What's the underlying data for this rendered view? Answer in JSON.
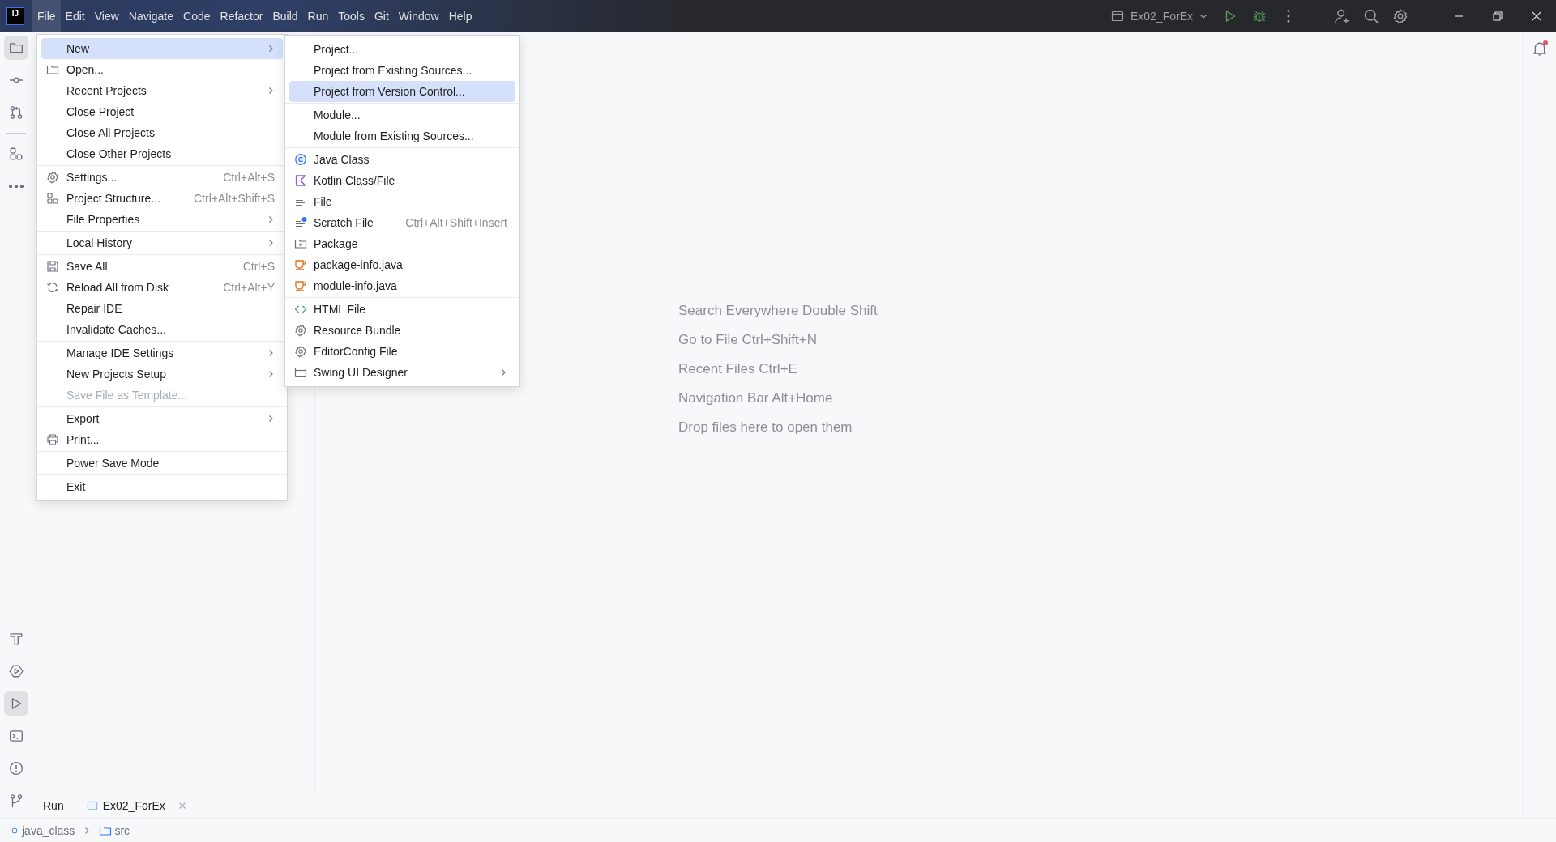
{
  "menubar": {
    "logo": "IJ",
    "items": [
      {
        "label": "File",
        "selected": true
      },
      {
        "label": "Edit",
        "selected": false
      },
      {
        "label": "View",
        "selected": false
      },
      {
        "label": "Navigate",
        "selected": false
      },
      {
        "label": "Code",
        "selected": false
      },
      {
        "label": "Refactor",
        "selected": false
      },
      {
        "label": "Build",
        "selected": false
      },
      {
        "label": "Run",
        "selected": false
      },
      {
        "label": "Tools",
        "selected": false
      },
      {
        "label": "Git",
        "selected": false
      },
      {
        "label": "Window",
        "selected": false
      },
      {
        "label": "Help",
        "selected": false
      }
    ]
  },
  "toolbar": {
    "run_configuration": "Ex02_ForEx"
  },
  "left_toolbar": {
    "top": [
      {
        "kind": "folder",
        "selected": true
      },
      {
        "kind": "commit",
        "selected": false
      },
      {
        "kind": "pull-requests",
        "selected": false
      },
      {
        "kind": "structure",
        "selected": false
      },
      {
        "kind": "more",
        "selected": false
      }
    ],
    "bottom": [
      {
        "kind": "build",
        "selected": false
      },
      {
        "kind": "services",
        "selected": false
      },
      {
        "kind": "run",
        "selected": true
      },
      {
        "kind": "terminal",
        "selected": false
      },
      {
        "kind": "problems",
        "selected": false
      },
      {
        "kind": "git",
        "selected": false
      }
    ]
  },
  "file_menu": {
    "groups": [
      [
        {
          "label": "New",
          "kind": "none",
          "submenu": true,
          "disabled": false,
          "selected": true
        },
        {
          "label": "Open...",
          "kind": "folder",
          "submenu": false,
          "disabled": false,
          "selected": false
        },
        {
          "label": "Recent Projects",
          "kind": "none",
          "submenu": true,
          "disabled": false,
          "selected": false
        },
        {
          "label": "Close Project",
          "kind": "none",
          "submenu": false,
          "disabled": false,
          "selected": false
        },
        {
          "label": "Close All Projects",
          "kind": "none",
          "submenu": false,
          "disabled": false,
          "selected": false
        },
        {
          "label": "Close Other Projects",
          "kind": "none",
          "submenu": false,
          "disabled": false,
          "selected": false
        }
      ],
      [
        {
          "label": "Settings...",
          "kind": "gear",
          "shortcut": "Ctrl+Alt+S",
          "submenu": false,
          "disabled": false,
          "selected": false
        },
        {
          "label": "Project Structure...",
          "kind": "structure",
          "shortcut": "Ctrl+Alt+Shift+S",
          "submenu": false,
          "disabled": false,
          "selected": false
        },
        {
          "label": "File Properties",
          "kind": "none",
          "submenu": true,
          "disabled": false,
          "selected": false
        }
      ],
      [
        {
          "label": "Local History",
          "kind": "none",
          "submenu": true,
          "disabled": false,
          "selected": false
        }
      ],
      [
        {
          "label": "Save All",
          "kind": "save",
          "shortcut": "Ctrl+S",
          "submenu": false,
          "disabled": false,
          "selected": false
        },
        {
          "label": "Reload All from Disk",
          "kind": "reload",
          "shortcut": "Ctrl+Alt+Y",
          "submenu": false,
          "disabled": false,
          "selected": false
        },
        {
          "label": "Repair IDE",
          "kind": "none",
          "submenu": false,
          "disabled": false,
          "selected": false
        },
        {
          "label": "Invalidate Caches...",
          "kind": "none",
          "submenu": false,
          "disabled": false,
          "selected": false
        }
      ],
      [
        {
          "label": "Manage IDE Settings",
          "kind": "none",
          "submenu": true,
          "disabled": false,
          "selected": false
        },
        {
          "label": "New Projects Setup",
          "kind": "none",
          "submenu": true,
          "disabled": false,
          "selected": false
        },
        {
          "label": "Save File as Template...",
          "kind": "none",
          "submenu": false,
          "disabled": true,
          "selected": false
        }
      ],
      [
        {
          "label": "Export",
          "kind": "none",
          "submenu": true,
          "disabled": false,
          "selected": false
        },
        {
          "label": "Print...",
          "kind": "print",
          "submenu": false,
          "disabled": false,
          "selected": false
        }
      ],
      [
        {
          "label": "Power Save Mode",
          "kind": "none",
          "submenu": false,
          "disabled": false,
          "selected": false
        }
      ],
      [
        {
          "label": "Exit",
          "kind": "none",
          "submenu": false,
          "disabled": false,
          "selected": false
        }
      ]
    ]
  },
  "new_submenu": {
    "groups": [
      [
        {
          "label": "Project...",
          "kind": "none",
          "submenu": false,
          "disabled": false,
          "selected": false
        },
        {
          "label": "Project from Existing Sources...",
          "kind": "none",
          "submenu": false,
          "disabled": false,
          "selected": false
        },
        {
          "label": "Project from Version Control...",
          "kind": "none",
          "submenu": false,
          "disabled": false,
          "selected": true
        }
      ],
      [
        {
          "label": "Module...",
          "kind": "none",
          "submenu": false,
          "disabled": false,
          "selected": false
        },
        {
          "label": "Module from Existing Sources...",
          "kind": "none",
          "submenu": false,
          "disabled": false,
          "selected": false
        }
      ],
      [
        {
          "label": "Java Class",
          "kind": "java-class",
          "submenu": false,
          "disabled": false,
          "selected": false
        },
        {
          "label": "Kotlin Class/File",
          "kind": "kotlin",
          "submenu": false,
          "disabled": false,
          "selected": false
        },
        {
          "label": "File",
          "kind": "file",
          "submenu": false,
          "disabled": false,
          "selected": false
        },
        {
          "label": "Scratch File",
          "kind": "scratch",
          "shortcut": "Ctrl+Alt+Shift+Insert",
          "submenu": false,
          "disabled": false,
          "selected": false
        },
        {
          "label": "Package",
          "kind": "package",
          "submenu": false,
          "disabled": false,
          "selected": false
        },
        {
          "label": "package-info.java",
          "kind": "java-file",
          "submenu": false,
          "disabled": false,
          "selected": false
        },
        {
          "label": "module-info.java",
          "kind": "java-file",
          "submenu": false,
          "disabled": false,
          "selected": false
        }
      ],
      [
        {
          "label": "HTML File",
          "kind": "html",
          "submenu": false,
          "disabled": false,
          "selected": false
        },
        {
          "label": "Resource Bundle",
          "kind": "gear",
          "submenu": false,
          "disabled": false,
          "selected": false
        },
        {
          "label": "EditorConfig File",
          "kind": "gear",
          "submenu": false,
          "disabled": false,
          "selected": false
        },
        {
          "label": "Swing UI Designer",
          "kind": "window",
          "submenu": true,
          "disabled": false,
          "selected": false
        }
      ]
    ]
  },
  "editor": {
    "hints": [
      "Search Everywhere Double Shift",
      "Go to File Ctrl+Shift+N",
      "Recent Files Ctrl+E",
      "Navigation Bar Alt+Home",
      "Drop files here to open them"
    ]
  },
  "run_panel": {
    "title": "Run",
    "tab": "Ex02_ForEx"
  },
  "status_bar": {
    "breadcrumbs": [
      {
        "label": "java_class",
        "kind": "module"
      },
      {
        "label": "src",
        "kind": "folder"
      }
    ]
  },
  "notifications": {
    "unread": true
  }
}
